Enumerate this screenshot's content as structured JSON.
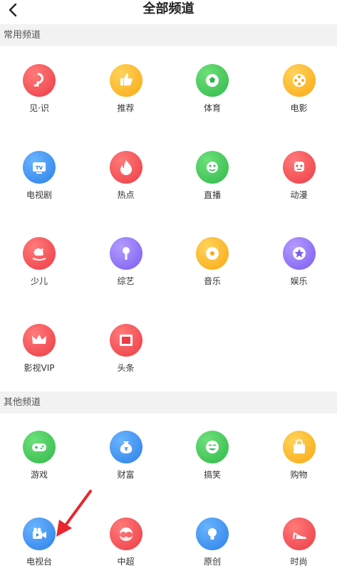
{
  "header": {
    "title": "全部频道",
    "back_icon": "chevron-left-icon"
  },
  "sections": [
    {
      "title": "常用频道",
      "items": [
        {
          "label": "见·识",
          "icon": "lightbulb-icon",
          "color": "red"
        },
        {
          "label": "推荐",
          "icon": "thumbs-up-icon",
          "color": "yellow"
        },
        {
          "label": "体育",
          "icon": "soccer-ball-icon",
          "color": "green"
        },
        {
          "label": "电影",
          "icon": "film-reel-icon",
          "color": "yellow"
        },
        {
          "label": "电视剧",
          "icon": "tv-icon",
          "color": "blue"
        },
        {
          "label": "热点",
          "icon": "flame-icon",
          "color": "red"
        },
        {
          "label": "直播",
          "icon": "broadcast-icon",
          "color": "green"
        },
        {
          "label": "动漫",
          "icon": "anime-character-icon",
          "color": "red"
        },
        {
          "label": "少儿",
          "icon": "rocking-horse-icon",
          "color": "red"
        },
        {
          "label": "综艺",
          "icon": "microphone-icon",
          "color": "purple"
        },
        {
          "label": "音乐",
          "icon": "disc-icon",
          "color": "yellow"
        },
        {
          "label": "娱乐",
          "icon": "star-icon",
          "color": "purple"
        },
        {
          "label": "影视VIP",
          "icon": "crown-icon",
          "color": "red"
        },
        {
          "label": "头条",
          "icon": "news-film-icon",
          "color": "red"
        }
      ]
    },
    {
      "title": "其他频道",
      "items": [
        {
          "label": "游戏",
          "icon": "gamepad-icon",
          "color": "green"
        },
        {
          "label": "财富",
          "icon": "money-bag-icon",
          "color": "blue"
        },
        {
          "label": "搞笑",
          "icon": "laughing-face-icon",
          "color": "green"
        },
        {
          "label": "购物",
          "icon": "shopping-bag-icon",
          "color": "yellow"
        },
        {
          "label": "电视台",
          "icon": "video-camera-icon",
          "color": "blue"
        },
        {
          "label": "中超",
          "icon": "swirl-logo-icon",
          "color": "red"
        },
        {
          "label": "原创",
          "icon": "bulb-icon",
          "color": "blue"
        },
        {
          "label": "时尚",
          "icon": "high-heel-icon",
          "color": "red"
        }
      ]
    }
  ],
  "annotation": {
    "icon": "red-arrow-icon",
    "color": "#e8262c"
  }
}
